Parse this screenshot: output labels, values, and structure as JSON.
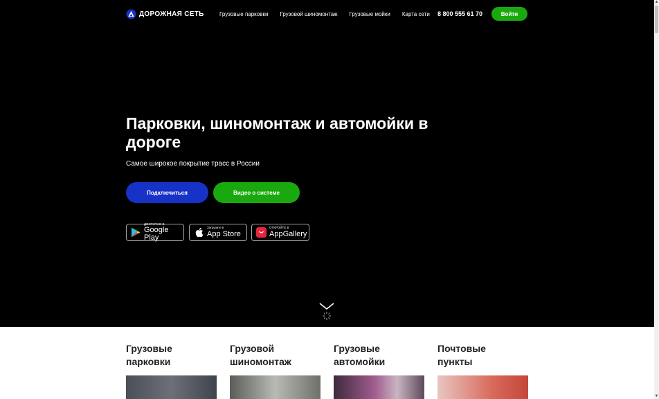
{
  "header": {
    "logo_text": "ДОРОЖНАЯ СЕТЬ",
    "nav": [
      {
        "label": "Грузовые парковки"
      },
      {
        "label": "Грузовой шиномонтаж"
      },
      {
        "label": "Грузовые мойки"
      },
      {
        "label": "Карта сети"
      }
    ],
    "phone": "8 800 555 61 70",
    "login_label": "Войти"
  },
  "hero": {
    "title": "Парковки, шиномонтаж и автомойки в дороге",
    "subtitle": "Самое широкое покрытие трасс в России",
    "connect_label": "Подключиться",
    "video_label": "Видео о системе",
    "stores": [
      {
        "small": "ДОСТУПНО В",
        "big": "Google Play",
        "icon": "google-play-icon"
      },
      {
        "small": "Загрузите в",
        "big": "App Store",
        "icon": "apple-icon"
      },
      {
        "small": "ОТКРОЙТЕ В",
        "big": "AppGallery",
        "icon": "huawei-icon"
      }
    ]
  },
  "services": [
    {
      "title_line1": "Грузовые",
      "title_line2": "парковки"
    },
    {
      "title_line1": "Грузовой",
      "title_line2": "шиномонтаж"
    },
    {
      "title_line1": "Грузовые",
      "title_line2": "автомойки"
    },
    {
      "title_line1": "Почтовые",
      "title_line2": "пункты"
    }
  ],
  "colors": {
    "hero_bg": "#000000",
    "accent_green": "#1aa80f",
    "accent_blue": "#1732c6"
  }
}
